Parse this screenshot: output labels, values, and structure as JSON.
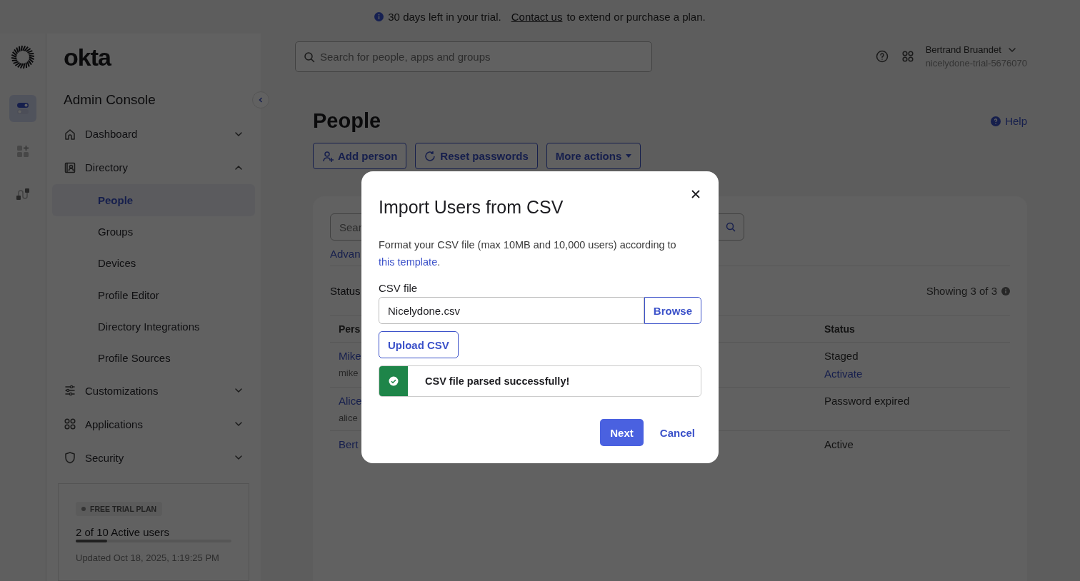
{
  "banner": {
    "message": "30 days left in your trial.",
    "link": "Contact us",
    "suffix": "to extend or purchase a plan."
  },
  "brand": "okta",
  "rail": [
    {
      "kind": "toggles",
      "selected": true
    },
    {
      "kind": "apps",
      "selected": false
    },
    {
      "kind": "workflow",
      "selected": false
    }
  ],
  "sidebar": {
    "title": "Admin Console",
    "items": [
      {
        "label": "Dashboard",
        "kind": "home",
        "expanded": false
      },
      {
        "label": "Directory",
        "kind": "directory",
        "expanded": true,
        "children": [
          {
            "label": "People",
            "selected": true
          },
          {
            "label": "Groups",
            "selected": false
          },
          {
            "label": "Devices",
            "selected": false
          },
          {
            "label": "Profile Editor",
            "selected": false
          },
          {
            "label": "Directory Integrations",
            "selected": false
          },
          {
            "label": "Profile Sources",
            "selected": false
          }
        ]
      },
      {
        "label": "Customizations",
        "kind": "sliders",
        "expanded": false
      },
      {
        "label": "Applications",
        "kind": "apps",
        "expanded": false
      },
      {
        "label": "Security",
        "kind": "shield",
        "expanded": false
      }
    ]
  },
  "trial": {
    "badge": "FREE TRIAL PLAN",
    "usage": "2 of 10 Active users",
    "level": 0.2,
    "updated": "Updated Oct 18, 2025, 1:19:25 PM"
  },
  "header": {
    "search_placeholder": "Search for people, apps and groups",
    "user_name": "Bertrand Bruandet",
    "org": "nicelydone-trial-5676070"
  },
  "page": {
    "title": "People",
    "help": "Help",
    "actions": [
      {
        "label": "Add person",
        "kind": "add"
      },
      {
        "label": "Reset passwords",
        "kind": "reset"
      },
      {
        "label": "More actions",
        "kind": "menu"
      }
    ],
    "search_placeholder": "Sear",
    "advanced": "Advan",
    "filter_label": "Status",
    "count": "Showing 3 of 3",
    "table": {
      "columns": [
        "Pers",
        "Status"
      ],
      "rows": [
        {
          "name": "Mike",
          "email": "mike",
          "status": "Staged",
          "action": "Activate"
        },
        {
          "name": "Alice",
          "email": "alice",
          "status": "Password expired"
        },
        {
          "name": "Bert",
          "status": "Active"
        }
      ]
    }
  },
  "modal": {
    "title": "Import Users from CSV",
    "description": "Format your CSV file (max 10MB and 10,000 users) according to",
    "link": "this template",
    "link_suffix": ".",
    "field_label": "CSV file",
    "file_value": "Nicelydone.csv",
    "browse": "Browse",
    "upload": "Upload CSV",
    "alert": {
      "kind": "success",
      "message": "CSV file parsed successfully!"
    },
    "primary": "Next",
    "secondary": "Cancel"
  }
}
